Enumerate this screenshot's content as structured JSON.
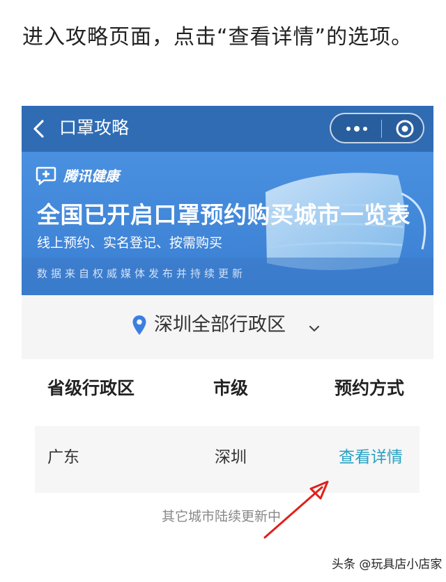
{
  "article": {
    "text": "进入攻略页面，点击“查看详情”的选项。"
  },
  "miniapp": {
    "back_icon": "chevron-left-icon",
    "title": "口罩攻略",
    "more_icon": "more-dots-icon",
    "close_icon": "target-circle-icon"
  },
  "banner": {
    "brand": "腾讯健康",
    "headline": "全国已开启口罩预约购买城市一览表",
    "subheadline": "线上预约、实名登记、按需购买",
    "source": "数据来自权威媒体发布并持续更新",
    "bg_color": "#3d83d6"
  },
  "region": {
    "pin_icon": "location-pin-icon",
    "label": "深圳全部行政区",
    "chevron_icon": "chevron-down-icon"
  },
  "table": {
    "headers": [
      "省级行政区",
      "市级",
      "预约方式"
    ],
    "rows": [
      {
        "province": "广东",
        "city": "深圳",
        "method": "查看详情"
      }
    ]
  },
  "footer_note": "其它城市陆续更新中",
  "watermark": "头条 @玩具店小店家",
  "colors": {
    "navbar": "#2f6cb4",
    "link": "#27a1c4",
    "arrow": "#e0201b"
  }
}
